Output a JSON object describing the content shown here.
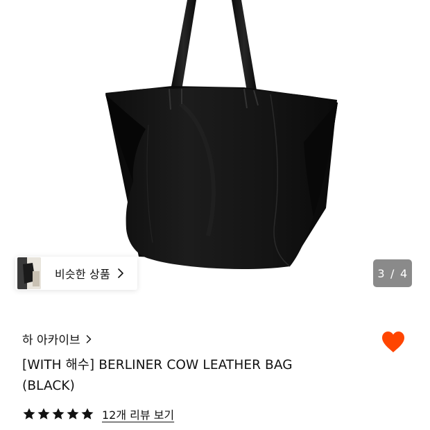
{
  "gallery": {
    "current": "3",
    "separator": "/",
    "total": "4",
    "similar_label": "비슷한 상품"
  },
  "product": {
    "brand": "하 아카이브",
    "title_line1": "[WITH 해수] BERLINER COW LEATHER BAG",
    "title_line2": "(BLACK)",
    "rating_stars": 5,
    "reviews_link": "12개 리뷰 보기",
    "wishlisted": true
  },
  "colors": {
    "heart": "#ff4500",
    "counter_bg": "#8a8a8a",
    "bag": "#141414"
  },
  "icons": {
    "similar_thumb": "bag-thumbnail",
    "chevron": "chevron-right-icon",
    "heart": "heart-icon",
    "star": "star-icon"
  }
}
